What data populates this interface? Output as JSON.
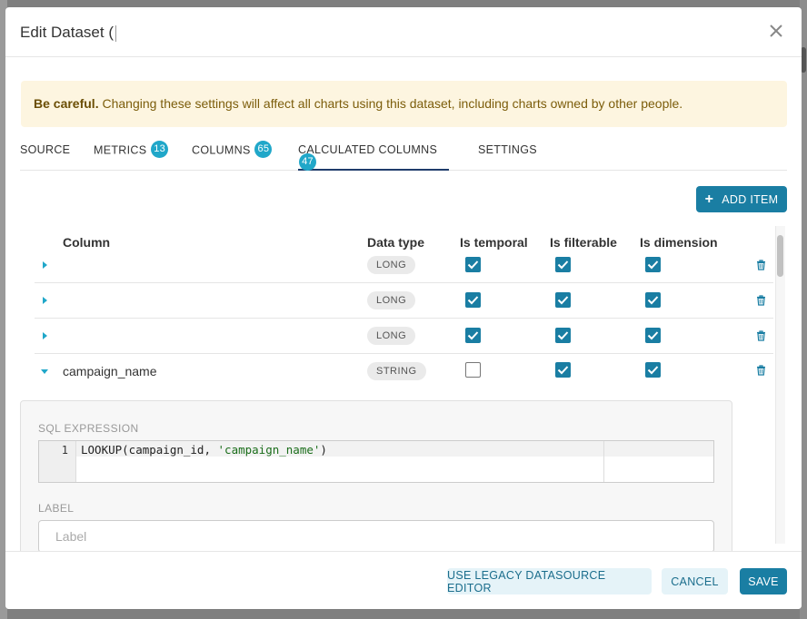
{
  "modal": {
    "title": "Edit Dataset (",
    "close_icon": "close-icon"
  },
  "alert": {
    "bold": "Be careful.",
    "text": " Changing these settings will affect all charts using this dataset, including charts owned by other people."
  },
  "tabs": [
    {
      "label": "SOURCE",
      "badge": null
    },
    {
      "label": "METRICS",
      "badge": "13"
    },
    {
      "label": "COLUMNS",
      "badge": "65"
    },
    {
      "label": "CALCULATED COLUMNS",
      "badge": "47",
      "active": true
    },
    {
      "label": "SETTINGS",
      "badge": null
    }
  ],
  "add_item_label": "ADD ITEM",
  "table": {
    "headers": {
      "column": "Column",
      "data_type": "Data type",
      "is_temporal": "Is temporal",
      "is_filterable": "Is filterable",
      "is_dimension": "Is dimension"
    },
    "rows": [
      {
        "name": "",
        "type": "LONG",
        "temporal": true,
        "filterable": true,
        "dimension": true,
        "expanded": false
      },
      {
        "name": "",
        "type": "LONG",
        "temporal": true,
        "filterable": true,
        "dimension": true,
        "expanded": false
      },
      {
        "name": "",
        "type": "LONG",
        "temporal": true,
        "filterable": true,
        "dimension": true,
        "expanded": false
      },
      {
        "name": "campaign_name",
        "type": "STRING",
        "temporal": false,
        "filterable": true,
        "dimension": true,
        "expanded": true
      }
    ]
  },
  "detail": {
    "sql_label": "SQL EXPRESSION",
    "line_number": "1",
    "code_prefix": "LOOKUP(campaign_id, ",
    "code_string": "'campaign_name'",
    "code_suffix": ")",
    "label_label": "LABEL",
    "label_placeholder": "Label"
  },
  "footer": {
    "legacy": "USE LEGACY DATASOURCE EDITOR",
    "cancel": "CANCEL",
    "save": "SAVE"
  },
  "colors": {
    "accent": "#1a7ea3",
    "badge": "#20a7c9",
    "alert_bg": "#fdf5e0"
  }
}
